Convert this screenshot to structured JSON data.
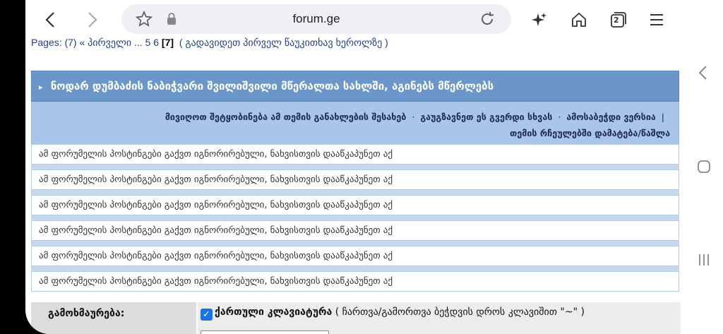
{
  "browser": {
    "url": "forum.ge",
    "tab_count": "2"
  },
  "page": {
    "pages_label": "Pages: (7)",
    "first_link": "« პირველი ...",
    "page_5": "5",
    "page_6": "6",
    "current_page": "[7]",
    "goto_first_unread": "( გადავიდეთ პირველ წაუკითხავ ხეროლზე )",
    "topic_title": "ნოდარ დუმბაძის ნაბიჭვარი შვილიშვილი მწერალთა სახლში, აგინებს მწერლებს",
    "options": {
      "track": "მივიღოთ შეტყობინება ამ თემის განახლების შესახებ",
      "send": "გაუგზავნეთ ეს გვერდი სხვას",
      "print": "ამოსაბეჭდი ვერსია",
      "favorites": "თემის რჩეულებში დამატება/წაშლა"
    },
    "ignored_rows": [
      "ამ ფორუმელის პოსტინგები გაქვთ იგნორირებული, ნახვისთვის დააწკაპუნეთ აქ",
      "ამ ფორუმელის პოსტინგები გაქვთ იგნორირებული, ნახვისთვის დააწკაპუნეთ აქ",
      "ამ ფორუმელის პოსტინგები გაქვთ იგნორირებული, ნახვისთვის დააწკაპუნეთ აქ",
      "ამ ფორუმელის პოსტინგები გაქვთ იგნორირებული, ნახვისთვის დააწკაპუნეთ აქ",
      "ამ ფორუმელის პოსტინგები გაქვთ იგნორირებული, ნახვისთვის დააწკაპუნეთ აქ",
      "ამ ფორუმელის პოსტინგები გაქვთ იგნორირებული, ნახვისთვის დააწკაპუნეთ აქ"
    ],
    "reply_label": "გამოხმაურება:",
    "keyboard_label": "ქართული კლავიატურა",
    "keyboard_hint": "( ჩართვა/გამორთვა ბეჭდვის დროს კლავიშით \"~\" )"
  }
}
